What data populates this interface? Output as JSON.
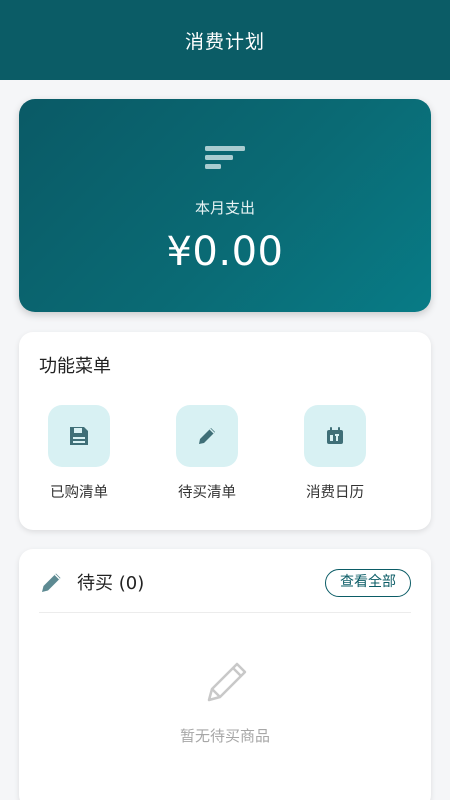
{
  "header": {
    "title": "消费计划"
  },
  "summary": {
    "icon": "sort-lines-icon",
    "label": "本月支出",
    "amount": "¥0.00"
  },
  "menu": {
    "title": "功能菜单",
    "items": [
      {
        "label": "已购清单",
        "icon": "save-disk-icon"
      },
      {
        "label": "待买清单",
        "icon": "pencil-icon"
      },
      {
        "label": "消费日历",
        "icon": "calendar-icon"
      }
    ]
  },
  "todo": {
    "title": "待买 (0)",
    "view_all": "查看全部",
    "empty_text": "暂无待买商品",
    "icon": "pencil-icon"
  },
  "colors": {
    "primary": "#0b5c66",
    "icon_bg": "#d8f1f3",
    "icon_fg": "#3f6f77"
  }
}
